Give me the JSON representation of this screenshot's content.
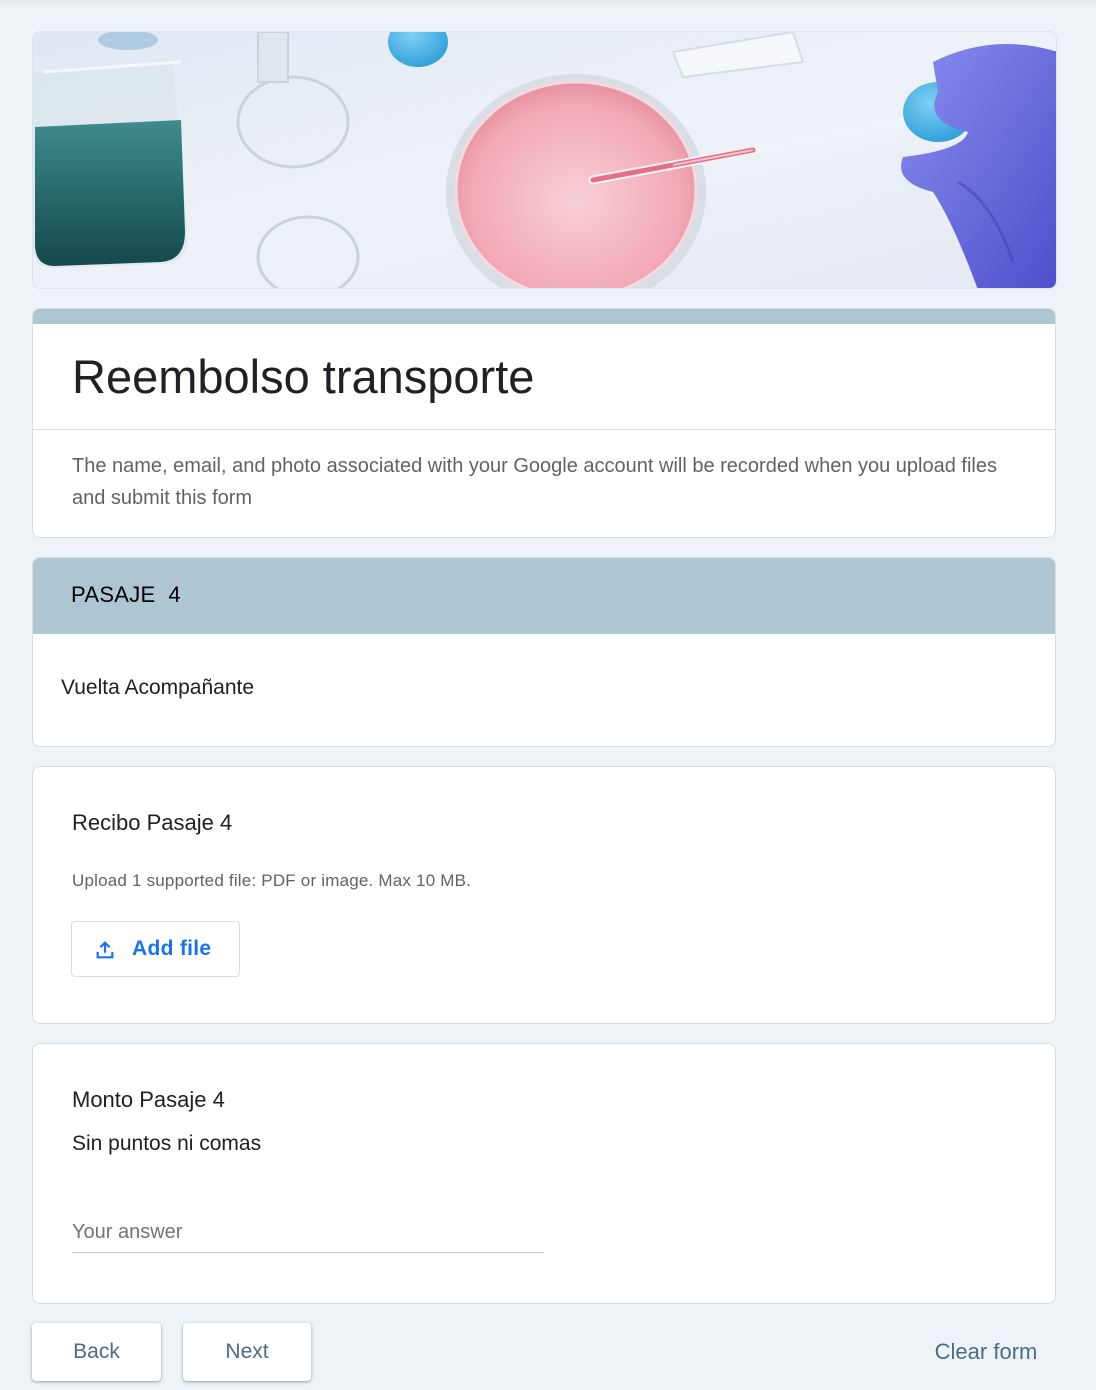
{
  "banner": {
    "icon": "lab-petri-dish-banner"
  },
  "form": {
    "title": "Reembolso transporte",
    "description": "The name, email, and photo associated with your Google account will be recorded when you upload files and submit this form"
  },
  "section": {
    "title": "PASAJE  4",
    "description": "Vuelta Acompañante"
  },
  "questions": {
    "receipt": {
      "title": "Recibo Pasaje 4",
      "hint": "Upload 1 supported file: PDF or image. Max 10 MB.",
      "button_label": "Add file",
      "button_icon": "upload-icon"
    },
    "amount": {
      "title": "Monto Pasaje 4",
      "help": "Sin puntos ni comas",
      "placeholder": "Your answer",
      "value": ""
    }
  },
  "nav": {
    "back_label": "Back",
    "next_label": "Next",
    "clear_label": "Clear form"
  },
  "colors": {
    "page_background": "#eef3f7",
    "accent": "#aec5d4",
    "link_blue": "#1a73e8",
    "button_text": "#4a6c85"
  }
}
